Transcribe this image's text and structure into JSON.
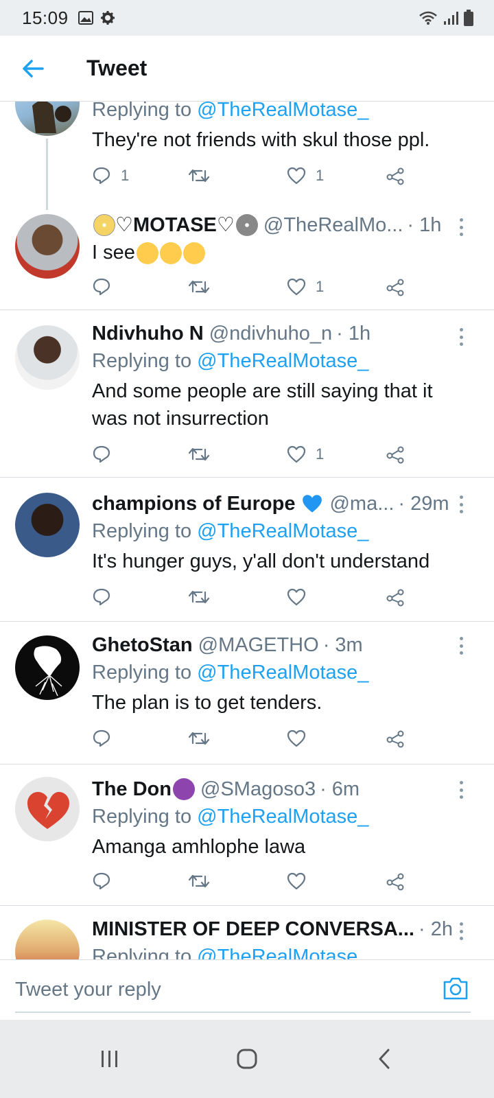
{
  "status_bar": {
    "time": "15:09"
  },
  "header": {
    "title": "Tweet"
  },
  "reply_prefix": "Replying to",
  "tweets": [
    {
      "name": "",
      "handle": "",
      "time": "",
      "replying_to": "@TheRealMotase_",
      "text": "They're not friends with skul those ppl.",
      "reply_count": "1",
      "like_count": "1"
    },
    {
      "name": "♡MOTASE♡",
      "handle": "@TheRealMo...",
      "time": "· 1h",
      "text": "I see",
      "reply_count": "",
      "like_count": "1"
    },
    {
      "name": "Ndivhuho N",
      "handle": "@ndivhuho_n",
      "time": "· 1h",
      "replying_to": "@TheRealMotase_",
      "text": "And some people are still saying that it was not insurrection",
      "reply_count": "",
      "like_count": "1"
    },
    {
      "name": "champions of Europe",
      "handle": "@ma...",
      "time": "· 29m",
      "replying_to": "@TheRealMotase_",
      "text": "It's hunger guys, y'all don't understand",
      "reply_count": "",
      "like_count": ""
    },
    {
      "name": "GhetoStan",
      "handle": "@MAGETHO",
      "time": "· 3m",
      "replying_to": "@TheRealMotase_",
      "text": "The plan is to get tenders.",
      "reply_count": "",
      "like_count": ""
    },
    {
      "name": "The Don",
      "handle": "@SMagoso3",
      "time": "· 6m",
      "replying_to": "@TheRealMotase_",
      "text": "Amanga amhlophe lawa",
      "reply_count": "",
      "like_count": ""
    },
    {
      "name": "MINISTER OF DEEP CONVERSA...",
      "handle": "",
      "time": "· 2h",
      "replying_to": "@TheRealMotase_",
      "text": ""
    }
  ],
  "reply_bar": {
    "placeholder": "Tweet your reply"
  },
  "colors": {
    "accent": "#1da1f2",
    "secondary_text": "#657786",
    "divider": "#d9dde1"
  },
  "icons": [
    "back-arrow-icon",
    "reply-icon",
    "retweet-icon",
    "like-icon",
    "share-icon",
    "more-icon",
    "camera-icon",
    "recents-icon",
    "home-icon",
    "nav-back-icon"
  ]
}
